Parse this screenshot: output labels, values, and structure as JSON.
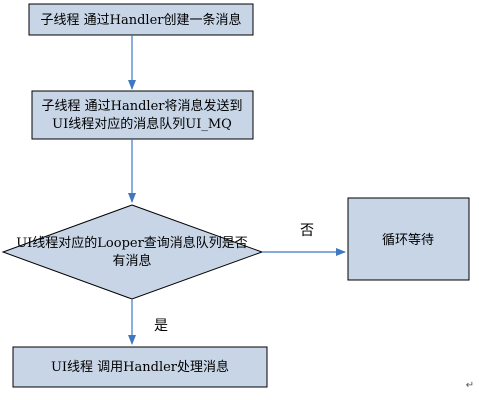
{
  "colors": {
    "node_fill": "#c7d5e6",
    "node_stroke": "#000000",
    "edge": "#3f78c0"
  },
  "nodes": {
    "step1": {
      "text": "子线程 通过Handler创建一条消息"
    },
    "step2": {
      "line1": "子线程 通过Handler将消息发送到",
      "line2": "UI线程对应的消息队列UI_MQ"
    },
    "decision": {
      "line1": "UI线程对应的Looper查询消息队列是否",
      "line2": "有消息"
    },
    "wait": {
      "text": "循环等待"
    },
    "handle": {
      "text": "UI线程 调用Handler处理消息"
    }
  },
  "edges": {
    "no_label": "否",
    "yes_label": "是"
  },
  "return_mark": "↵"
}
